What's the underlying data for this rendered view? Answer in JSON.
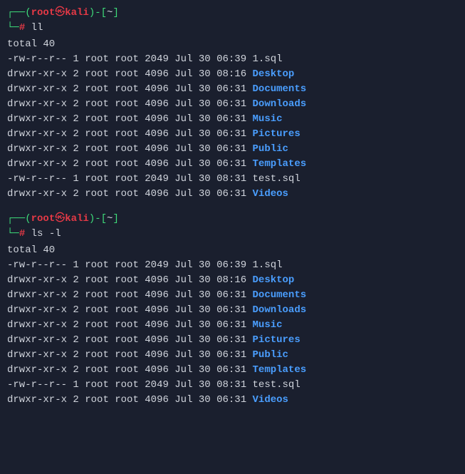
{
  "prompt": {
    "open": "┌──(",
    "user": "root",
    "symbol": "㉿",
    "host": "kali",
    "close": ")-[",
    "path": "~",
    "end": "]",
    "line2_prefix": "└─",
    "hash": "#"
  },
  "commands": {
    "cmd1": "ll",
    "cmd2": "ls -l"
  },
  "output": {
    "total": "total 40",
    "rows": [
      {
        "perm": "-rw-r--r--",
        "n": "1",
        "o": "root",
        "g": "root",
        "sz": "2049",
        "dt": "Jul 30 06:39",
        "name": "1.sql",
        "dir": false
      },
      {
        "perm": "drwxr-xr-x",
        "n": "2",
        "o": "root",
        "g": "root",
        "sz": "4096",
        "dt": "Jul 30 08:16",
        "name": "Desktop",
        "dir": true
      },
      {
        "perm": "drwxr-xr-x",
        "n": "2",
        "o": "root",
        "g": "root",
        "sz": "4096",
        "dt": "Jul 30 06:31",
        "name": "Documents",
        "dir": true
      },
      {
        "perm": "drwxr-xr-x",
        "n": "2",
        "o": "root",
        "g": "root",
        "sz": "4096",
        "dt": "Jul 30 06:31",
        "name": "Downloads",
        "dir": true
      },
      {
        "perm": "drwxr-xr-x",
        "n": "2",
        "o": "root",
        "g": "root",
        "sz": "4096",
        "dt": "Jul 30 06:31",
        "name": "Music",
        "dir": true
      },
      {
        "perm": "drwxr-xr-x",
        "n": "2",
        "o": "root",
        "g": "root",
        "sz": "4096",
        "dt": "Jul 30 06:31",
        "name": "Pictures",
        "dir": true
      },
      {
        "perm": "drwxr-xr-x",
        "n": "2",
        "o": "root",
        "g": "root",
        "sz": "4096",
        "dt": "Jul 30 06:31",
        "name": "Public",
        "dir": true
      },
      {
        "perm": "drwxr-xr-x",
        "n": "2",
        "o": "root",
        "g": "root",
        "sz": "4096",
        "dt": "Jul 30 06:31",
        "name": "Templates",
        "dir": true
      },
      {
        "perm": "-rw-r--r--",
        "n": "1",
        "o": "root",
        "g": "root",
        "sz": "2049",
        "dt": "Jul 30 08:31",
        "name": "test.sql",
        "dir": false
      },
      {
        "perm": "drwxr-xr-x",
        "n": "2",
        "o": "root",
        "g": "root",
        "sz": "4096",
        "dt": "Jul 30 06:31",
        "name": "Videos",
        "dir": true
      }
    ]
  }
}
